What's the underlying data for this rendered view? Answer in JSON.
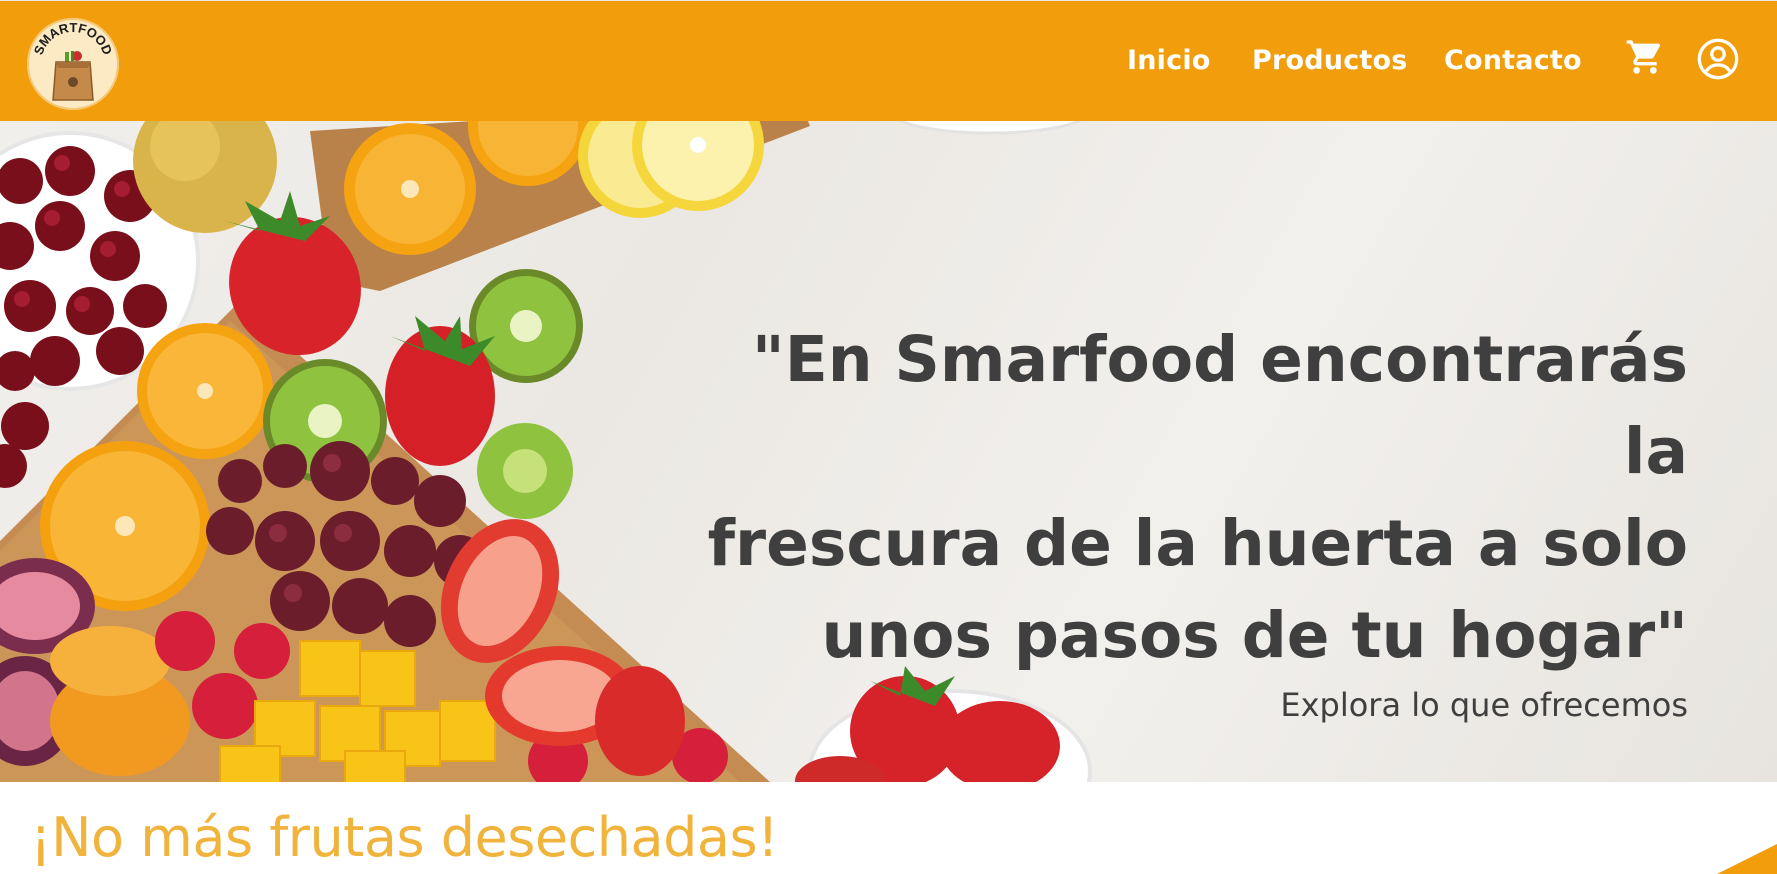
{
  "brand": {
    "logo_text": "SMARTFOOD"
  },
  "nav": {
    "items": [
      {
        "label": "Inicio"
      },
      {
        "label": "Productos"
      },
      {
        "label": "Contacto"
      }
    ],
    "cart_icon": "cart-icon",
    "user_icon": "user-circle-icon"
  },
  "hero": {
    "quote_line1": "\"En Smarfood encontrarás la",
    "quote_line2": "frescura de la huerta a solo",
    "quote_line3": "unos pasos de tu hogar\"",
    "subtitle": "Explora lo que ofrecemos"
  },
  "section": {
    "title": "¡No más frutas desechadas!"
  },
  "colors": {
    "navbar": "#f29d0c",
    "hero_text": "#3f3f3f",
    "section_title": "#f0b43c"
  }
}
